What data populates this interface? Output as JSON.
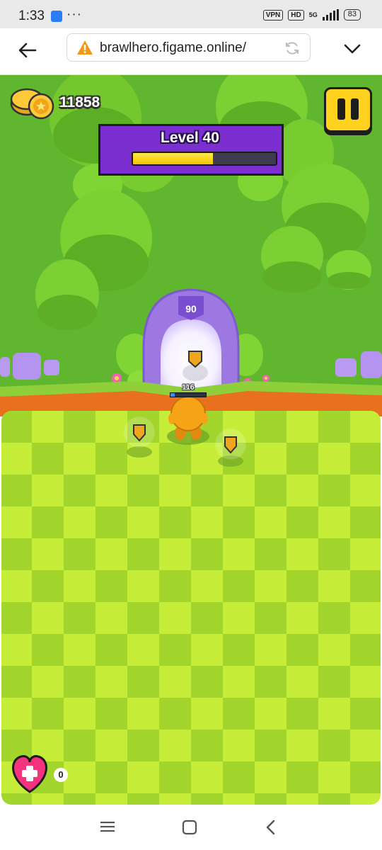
{
  "status_bar": {
    "time": "1:33",
    "dots": "···",
    "vpn": "VPN",
    "hd": "HD",
    "network": "5G",
    "battery": "83"
  },
  "browser": {
    "url": "brawlhero.figame.online/",
    "icons": [
      "back-arrow-icon",
      "warning-icon",
      "reload-icon",
      "chevron-down-icon"
    ]
  },
  "game": {
    "coins": "11858",
    "level": {
      "label": "Level 40",
      "progress": 0.56
    },
    "gate": {
      "number": "90"
    },
    "player": {
      "hp": "116",
      "hp_fraction": 0.12
    },
    "hearts": {
      "count": "0"
    },
    "colors": {
      "grass_light": "#c8f03a",
      "grass_dark": "#9fd52a",
      "panel_purple": "#7b2fd0",
      "pause_yellow": "#ffd21f",
      "player_orange": "#f7a318",
      "heart_pink": "#f5327d"
    }
  },
  "navbar": {
    "icons": [
      "menu-icon",
      "home-icon",
      "back-icon"
    ]
  }
}
